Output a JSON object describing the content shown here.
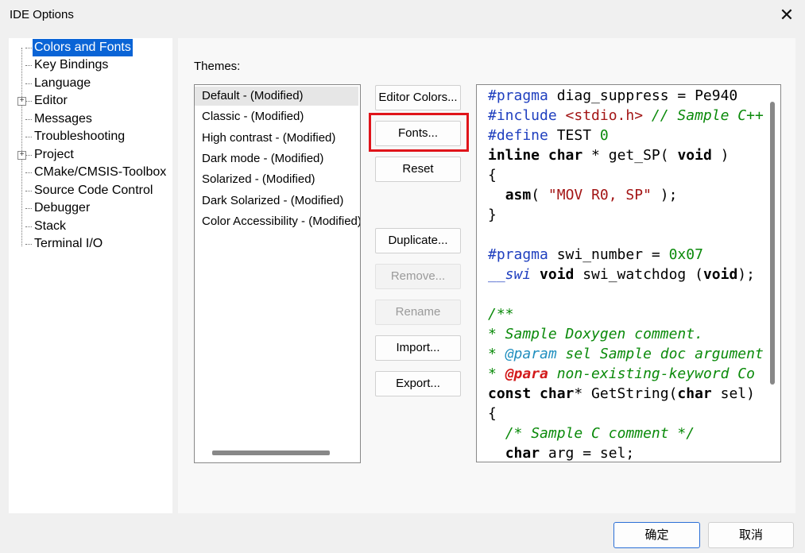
{
  "window": {
    "title": "IDE Options",
    "close_icon": "✕"
  },
  "tree": {
    "items": [
      {
        "label": "Colors and Fonts",
        "selected": true,
        "expandable": false
      },
      {
        "label": "Key Bindings",
        "selected": false,
        "expandable": false
      },
      {
        "label": "Language",
        "selected": false,
        "expandable": false
      },
      {
        "label": "Editor",
        "selected": false,
        "expandable": true
      },
      {
        "label": "Messages",
        "selected": false,
        "expandable": false
      },
      {
        "label": "Troubleshooting",
        "selected": false,
        "expandable": false
      },
      {
        "label": "Project",
        "selected": false,
        "expandable": true
      },
      {
        "label": "CMake/CMSIS-Toolbox",
        "selected": false,
        "expandable": false
      },
      {
        "label": "Source Code Control",
        "selected": false,
        "expandable": false
      },
      {
        "label": "Debugger",
        "selected": false,
        "expandable": false
      },
      {
        "label": "Stack",
        "selected": false,
        "expandable": false
      },
      {
        "label": "Terminal I/O",
        "selected": false,
        "expandable": false
      }
    ],
    "expander_symbol": "+"
  },
  "themes": {
    "label": "Themes:",
    "items": [
      "Default - (Modified)",
      "Classic - (Modified)",
      "High contrast - (Modified)",
      "Dark mode - (Modified)",
      "Solarized - (Modified)",
      "Dark Solarized - (Modified)",
      "Color Accessibility - (Modified)"
    ],
    "selected_index": 0
  },
  "buttons": {
    "editor_colors": "Editor Colors...",
    "fonts": "Fonts...",
    "reset": "Reset",
    "duplicate": "Duplicate...",
    "remove": "Remove...",
    "rename": "Rename",
    "import": "Import...",
    "export": "Export..."
  },
  "code_preview": {
    "l1_pp": "#pragma",
    "l1_rest": " diag_suppress = Pe940",
    "l2_pp": "#include",
    "l2_str": " <stdio.h>",
    "l2_cm": " // Sample C++",
    "l3_pp": "#define",
    "l3_rest": " TEST ",
    "l3_num": "0",
    "l4_kw1": "inline",
    "l4_kw2": " char",
    "l4_rest1": " * get_SP( ",
    "l4_kw3": "void",
    "l4_rest2": " )",
    "l5": "{",
    "l6_indent": "  ",
    "l6_kw": "asm",
    "l6_rest1": "( ",
    "l6_str": "\"MOV R0, SP\"",
    "l6_rest2": " );",
    "l7": "}",
    "l9_pp": "#pragma",
    "l9_rest": " swi_number = ",
    "l9_num": "0x07",
    "l10_pp": "__swi",
    "l10_kw1": " void",
    "l10_rest1": " swi_watchdog (",
    "l10_kw2": "void",
    "l10_rest2": ");",
    "l12_cm": "/**",
    "l13_cm": "* Sample Doxygen comment.",
    "l14_cm1": "* ",
    "l14_dox": "@param",
    "l14_cm2": " sel Sample doc argument",
    "l15_cm1": "* ",
    "l15_dox": "@para",
    "l15_cm2": " non-existing-keyword Co",
    "l16_kw1": "const",
    "l16_kw2": " char",
    "l16_rest1": "* GetString(",
    "l16_kw3": "char",
    "l16_rest2": " sel)",
    "l17": "{",
    "l18_indent": "  ",
    "l18_cm": "/* Sample C comment */",
    "l19_indent": "  ",
    "l19_kw": "char",
    "l19_rest": " arg = sel;"
  },
  "footer": {
    "ok": "确定",
    "cancel": "取消"
  },
  "colors": {
    "selection": "#0a64d6",
    "highlight": "#e0141a",
    "preprocessor": "#1f3fbf",
    "string": "#a31515",
    "comment": "#0a8a0a"
  }
}
